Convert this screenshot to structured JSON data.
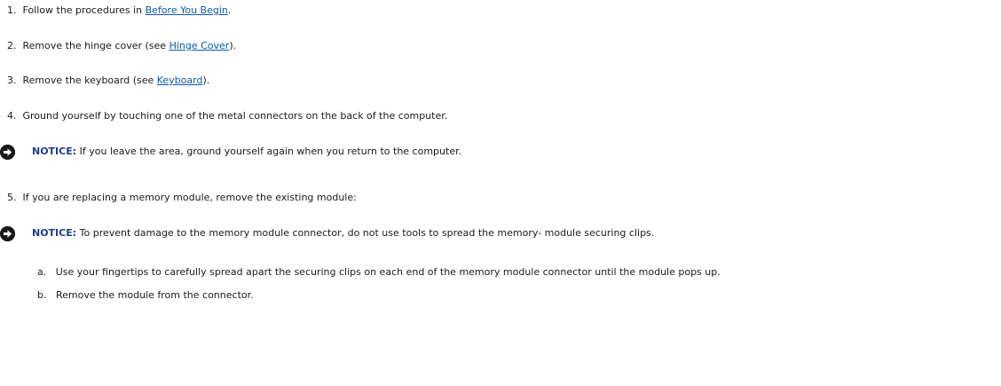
{
  "steps": [
    {
      "num": "1.",
      "pre": "Follow the procedures in ",
      "link": "Before You Begin",
      "post": "."
    },
    {
      "num": "2.",
      "pre": "Remove the hinge cover (see ",
      "link": "Hinge Cover",
      "post": ")."
    },
    {
      "num": "3.",
      "pre": "Remove the keyboard (see ",
      "link": "Keyboard",
      "post": ")."
    },
    {
      "num": "4.",
      "text": "Ground yourself by touching one of the metal connectors on the back of the computer."
    },
    {
      "num": "5.",
      "text": "If you are replacing a memory module, remove the existing module:"
    }
  ],
  "notices": [
    {
      "label": "NOTICE:",
      "text": " If you leave the area, ground yourself again when you return to the computer.",
      "icon": "notice-arrow-icon"
    },
    {
      "label": "NOTICE:",
      "text": " To prevent damage to the memory module connector, do not use tools to spread the memory- module securing clips.",
      "icon": "notice-arrow-icon"
    }
  ],
  "substeps": [
    {
      "letter": "a.",
      "text": "Use your fingertips to carefully spread apart the securing clips on each end of the memory module connector until the module pops up."
    },
    {
      "letter": "b.",
      "text": "Remove the module from the connector."
    }
  ]
}
